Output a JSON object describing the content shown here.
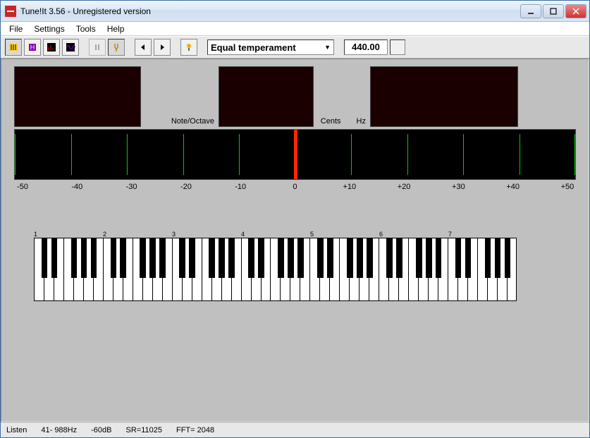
{
  "title": "Tune!It 3.56  -  Unregistered version",
  "menu": {
    "file": "File",
    "settings": "Settings",
    "tools": "Tools",
    "help": "Help"
  },
  "toolbar": {
    "temperament": "Equal temperament",
    "ref_freq": "440.00"
  },
  "labels": {
    "note_octave": "Note/Octave",
    "cents": "Cents",
    "hz": "Hz"
  },
  "scale": {
    "m50": "-50",
    "m40": "-40",
    "m30": "-30",
    "m20": "-20",
    "m10": "-10",
    "zero": "0",
    "p10": "+10",
    "p20": "+20",
    "p30": "+30",
    "p40": "+40",
    "p50": "+50"
  },
  "octaves": {
    "o1": "1",
    "o2": "2",
    "o3": "3",
    "o4": "4",
    "o5": "5",
    "o6": "6",
    "o7": "7"
  },
  "status": {
    "mode": "Listen",
    "range": "41-  988Hz",
    "level": "-60dB",
    "sr": "SR=11025",
    "fft": "FFT=  2048"
  }
}
